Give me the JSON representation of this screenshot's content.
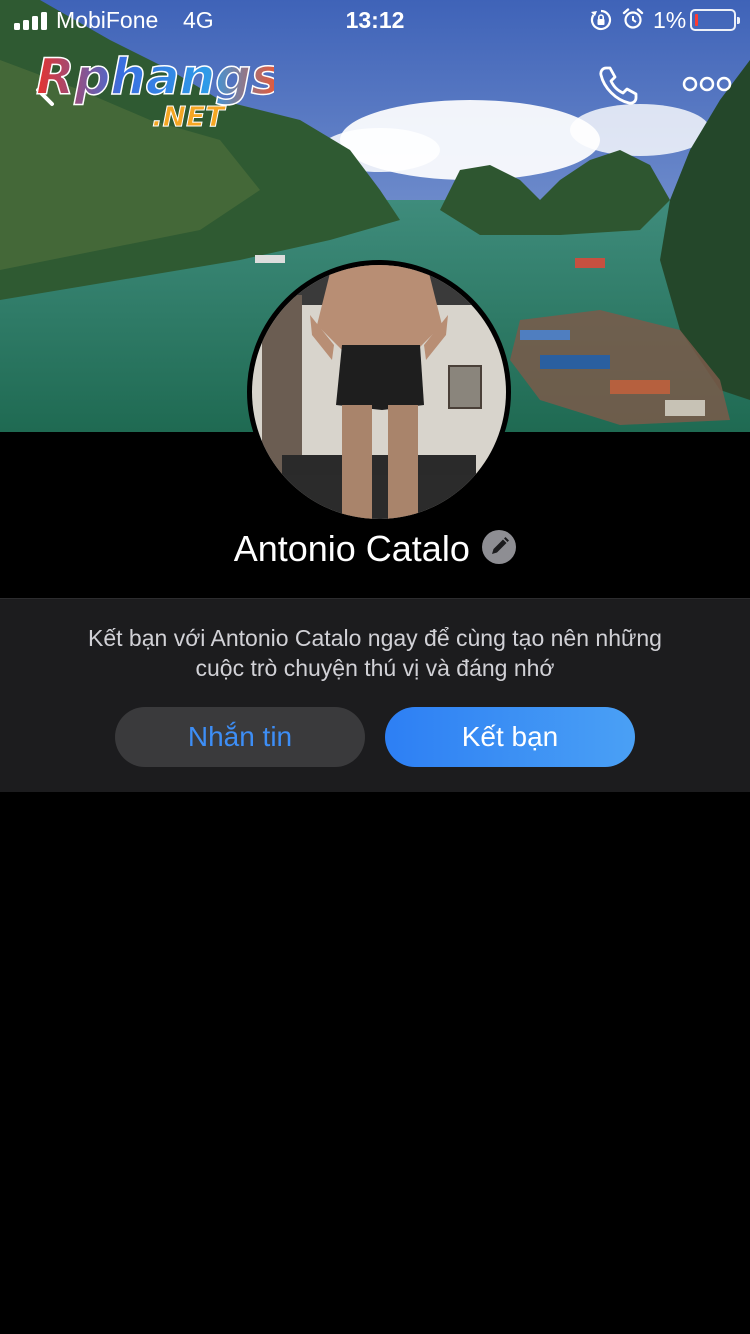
{
  "status_bar": {
    "carrier": "MobiFone",
    "network": "4G",
    "time": "13:12",
    "battery_percent": "1%",
    "icons": [
      "signal-icon",
      "rotation-lock-icon",
      "alarm-icon",
      "battery-icon"
    ]
  },
  "navigation": {
    "back_icon": "chevron-left-icon",
    "call_icon": "phone-icon",
    "more_icon": "more-dots-icon",
    "watermark_main": "Rphangs",
    "watermark_sub": ".NET"
  },
  "profile": {
    "name": "Antonio Catalo",
    "edit_icon": "pencil-icon"
  },
  "invite": {
    "message_line1": "Kết bạn với Antonio Catalo ngay để cùng tạo nên những",
    "message_line2": "cuộc trò chuyện thú vị và đáng nhớ",
    "message_button": "Nhắn tin",
    "add_friend_button": "Kết bạn"
  },
  "colors": {
    "accent_blue": "#3d8ef6",
    "panel_bg": "#1c1c1e",
    "battery_low": "#ff3b30"
  }
}
